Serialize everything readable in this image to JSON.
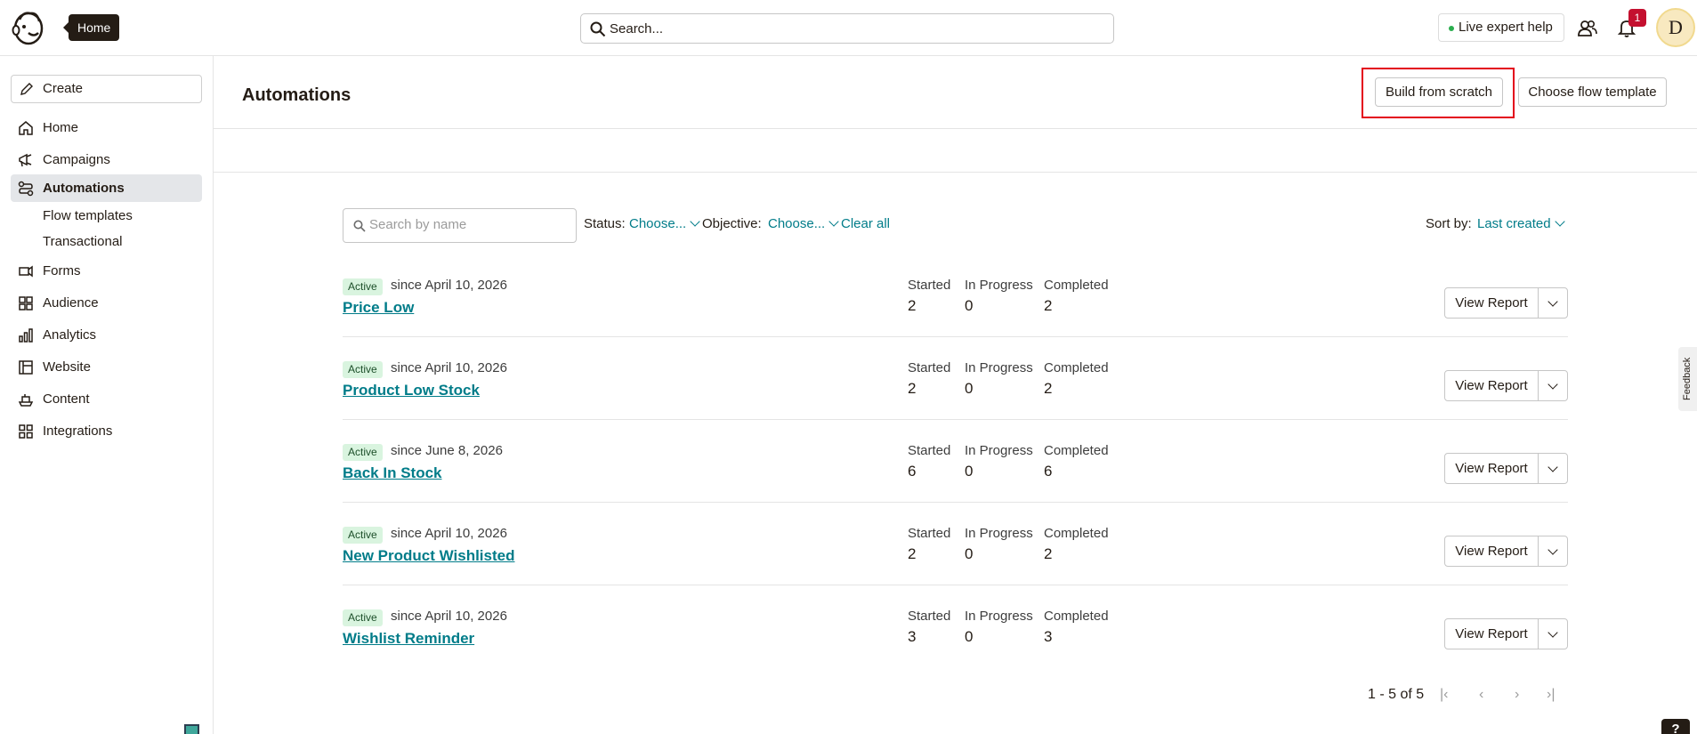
{
  "header": {
    "home_tooltip": "Home",
    "search_placeholder": "Search...",
    "live_help_label": "Live expert help",
    "notification_count": "1",
    "avatar_initial": "D"
  },
  "sidebar": {
    "create_label": "Create",
    "items": [
      {
        "label": "Home",
        "icon": "home-icon"
      },
      {
        "label": "Campaigns",
        "icon": "megaphone-icon"
      },
      {
        "label": "Automations",
        "icon": "flow-icon"
      },
      {
        "label": "Forms",
        "icon": "form-icon"
      },
      {
        "label": "Audience",
        "icon": "audience-icon"
      },
      {
        "label": "Analytics",
        "icon": "bar-chart-icon"
      },
      {
        "label": "Website",
        "icon": "website-icon"
      },
      {
        "label": "Content",
        "icon": "content-icon"
      },
      {
        "label": "Integrations",
        "icon": "grid-icon"
      }
    ],
    "subitems": [
      "Flow templates",
      "Transactional"
    ]
  },
  "main": {
    "title": "Automations",
    "build_from_scratch_label": "Build from scratch",
    "choose_template_label": "Choose flow template",
    "filters": {
      "search_placeholder": "Search by name",
      "status_label": "Status:",
      "status_value": "Choose...",
      "objective_label": "Objective:",
      "objective_value": "Choose...",
      "clear_all": "Clear all",
      "sort_label": "Sort by:",
      "sort_value": "Last created"
    },
    "stat_labels": {
      "started": "Started",
      "in_progress": "In Progress",
      "completed": "Completed"
    },
    "view_report_label": "View Report",
    "flows": [
      {
        "status": "Active",
        "since": "since April 10, 2026",
        "name": "Price Low",
        "started": "2",
        "in_progress": "0",
        "completed": "2"
      },
      {
        "status": "Active",
        "since": "since April 10, 2026",
        "name": "Product Low Stock",
        "started": "2",
        "in_progress": "0",
        "completed": "2"
      },
      {
        "status": "Active",
        "since": "since June 8, 2026",
        "name": "Back In Stock",
        "started": "6",
        "in_progress": "0",
        "completed": "6"
      },
      {
        "status": "Active",
        "since": "since April 10, 2026",
        "name": "New Product Wishlisted",
        "started": "2",
        "in_progress": "0",
        "completed": "2"
      },
      {
        "status": "Active",
        "since": "since April 10, 2026",
        "name": "Wishlist Reminder",
        "started": "3",
        "in_progress": "0",
        "completed": "3"
      }
    ],
    "pagination": {
      "summary": "1 - 5 of 5",
      "first": "|‹",
      "prev": "‹",
      "next": "›",
      "last": "›|"
    }
  },
  "feedback_label": "Feedback",
  "help_label": "?"
}
